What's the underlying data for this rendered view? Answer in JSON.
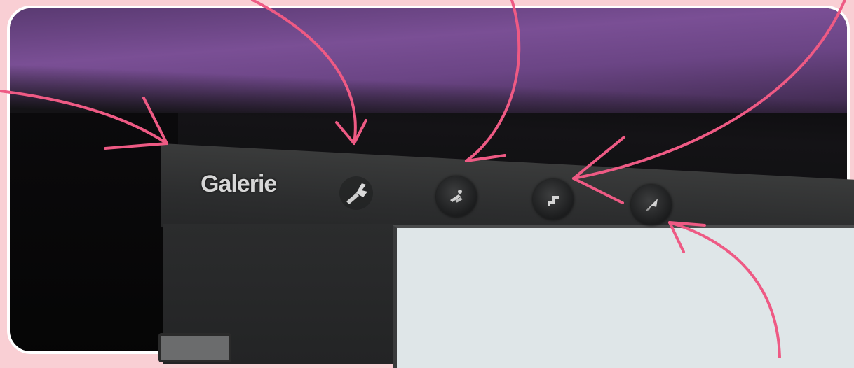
{
  "toolbar": {
    "gallery_label": "Galerie",
    "tools": [
      {
        "icon": "wrench-icon"
      },
      {
        "icon": "adjust-icon"
      },
      {
        "icon": "filter-icon"
      },
      {
        "icon": "share-icon"
      }
    ]
  },
  "colors": {
    "background": "#f9cfd4",
    "annotation": "#ee5a84",
    "bezel": "#6b4585",
    "toolbar": "#2c2d2e",
    "content": "#dfe6e8"
  }
}
